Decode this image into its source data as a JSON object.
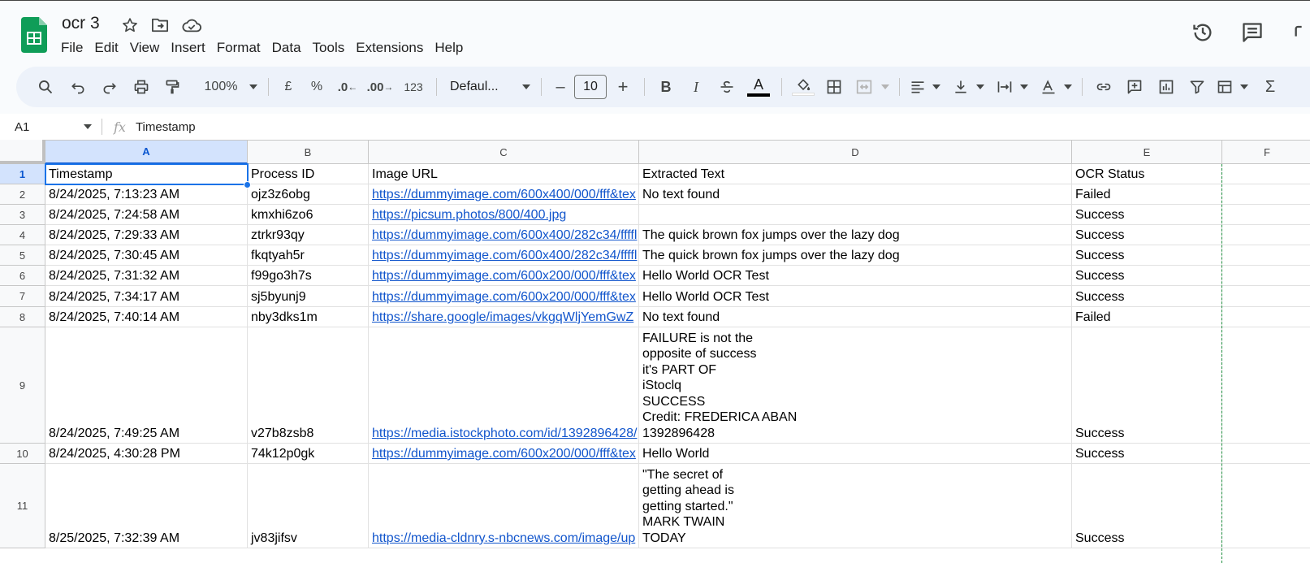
{
  "app": {
    "doc_title": "ocr 3",
    "menu": [
      "File",
      "Edit",
      "View",
      "Insert",
      "Format",
      "Data",
      "Tools",
      "Extensions",
      "Help"
    ]
  },
  "toolbar": {
    "zoom": "100%",
    "currency": "£",
    "percent": "%",
    "dec_decrease": ".0",
    "dec_increase": ".00",
    "number_format": "123",
    "font": "Defaul...",
    "font_size": "10",
    "minus": "–",
    "plus": "+",
    "bold": "B",
    "italic": "I",
    "text_color_letter": "A",
    "text_color": "#000000",
    "fill_color": "#ffffff"
  },
  "formula_bar": {
    "name_box": "A1",
    "fx": "fx",
    "content": "Timestamp"
  },
  "grid": {
    "columns": [
      "A",
      "B",
      "C",
      "D",
      "E",
      "F"
    ],
    "rows": [
      {
        "num": "1",
        "cells": [
          "Timestamp",
          "Process ID",
          "Image URL",
          "Extracted Text",
          "OCR Status"
        ]
      },
      {
        "num": "2",
        "cells": [
          "8/24/2025, 7:13:23 AM",
          "ojz3z6obg",
          "https://dummyimage.com/600x400/000/fff&tex",
          "No text found",
          "Failed"
        ]
      },
      {
        "num": "3",
        "cells": [
          "8/24/2025, 7:24:58 AM",
          "kmxhi6zo6",
          "https://picsum.photos/800/400.jpg",
          "",
          "Success"
        ]
      },
      {
        "num": "4",
        "cells": [
          "8/24/2025, 7:29:33 AM",
          "ztrkr93qy",
          "https://dummyimage.com/600x400/282c34/ffffl",
          "The quick brown fox jumps over the lazy dog",
          "Success"
        ]
      },
      {
        "num": "5",
        "cells": [
          "8/24/2025, 7:30:45 AM",
          "fkqtyah5r",
          "https://dummyimage.com/600x400/282c34/ffffl",
          "The quick brown fox jumps over the lazy dog",
          "Success"
        ]
      },
      {
        "num": "6",
        "cells": [
          "8/24/2025, 7:31:32 AM",
          "f99go3h7s",
          "https://dummyimage.com/600x200/000/fff&tex",
          "Hello World OCR Test",
          "Success"
        ]
      },
      {
        "num": "7",
        "cells": [
          "8/24/2025, 7:34:17 AM",
          "sj5byunj9",
          "https://dummyimage.com/600x200/000/fff&tex",
          "Hello World OCR Test",
          "Success"
        ]
      },
      {
        "num": "8",
        "cells": [
          "8/24/2025, 7:40:14 AM",
          "nby3dks1m",
          "https://share.google/images/vkgqWljYemGwZ",
          "No text found",
          "Failed"
        ]
      },
      {
        "num": "9",
        "cells": [
          "8/24/2025, 7:49:25 AM",
          "v27b8zsb8",
          "https://media.istockphoto.com/id/1392896428/",
          "FAILURE is not the\nopposite of success\nit's PART OF\niStoclq\nSUCCESS\nCredit: FREDERICA ABAN\n1392896428",
          "Success"
        ]
      },
      {
        "num": "10",
        "cells": [
          "8/24/2025, 4:30:28 PM",
          "74k12p0gk",
          "https://dummyimage.com/600x200/000/fff&tex",
          "Hello World",
          "Success"
        ]
      },
      {
        "num": "11",
        "cells": [
          "8/25/2025, 7:32:39 AM",
          "jv83jifsv",
          "https://media-cldnry.s-nbcnews.com/image/up",
          "\"The secret of\ngetting ahead is\ngetting started.\"\nMARK TWAIN\nTODAY",
          "Success"
        ]
      }
    ]
  },
  "colors": {
    "accent": "#0b57d0",
    "link": "#1155cc",
    "sheets_green": "#0f9d58"
  }
}
